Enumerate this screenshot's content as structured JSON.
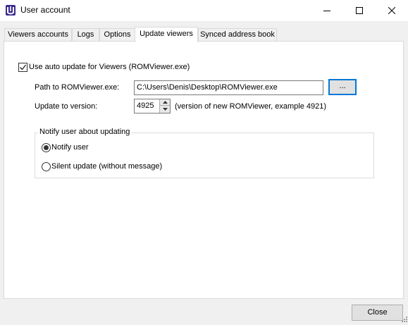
{
  "window": {
    "title": "User account",
    "icon": "app-logo-icon",
    "minimize_icon": "minimize-icon",
    "maximize_icon": "maximize-icon",
    "close_icon": "close-icon"
  },
  "tabs": [
    {
      "label": "Viewers accounts",
      "active": false
    },
    {
      "label": "Logs",
      "active": false
    },
    {
      "label": "Options",
      "active": false
    },
    {
      "label": "Update viewers",
      "active": true
    },
    {
      "label": "Synced address book",
      "active": false
    }
  ],
  "update_viewers": {
    "auto_update_label": "Use auto update for Viewers (ROMViewer.exe)",
    "auto_update_checked": true,
    "path_label": "Path to ROMViewer.exe:",
    "path_value": "C:\\Users\\Denis\\Desktop\\ROMViewer.exe",
    "browse_label": "...",
    "version_label": "Update to version:",
    "version_value": "4925",
    "version_hint": "(version of new ROMViewer, example 4921)",
    "notify_group_title": "Notify user about updating",
    "notify_options": [
      {
        "label": "Notify user",
        "selected": true
      },
      {
        "label": "Silent update (without message)",
        "selected": false
      }
    ]
  },
  "footer": {
    "close_label": "Close"
  },
  "colors": {
    "accent": "#0078d7",
    "panel_bg": "#ffffff",
    "window_bg": "#f0f0f0"
  }
}
